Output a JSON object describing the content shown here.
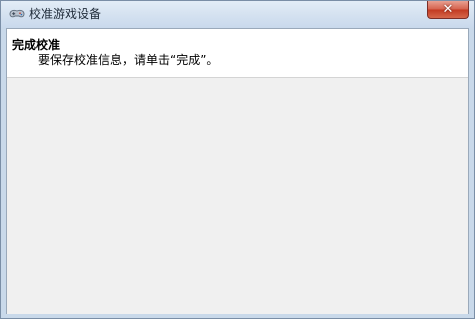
{
  "window": {
    "title": "校准游戏设备",
    "close_glyph": "✕"
  },
  "header": {
    "title": "完成校准",
    "subtitle": "要保存校准信息，请单击“完成”。"
  },
  "icons": {
    "app": "game-controller-icon",
    "close": "close-icon"
  },
  "colors": {
    "title_bar": "#d6e3f1",
    "close_button": "#c9452d",
    "client_background": "#f0f0f0",
    "header_background": "#ffffff"
  }
}
